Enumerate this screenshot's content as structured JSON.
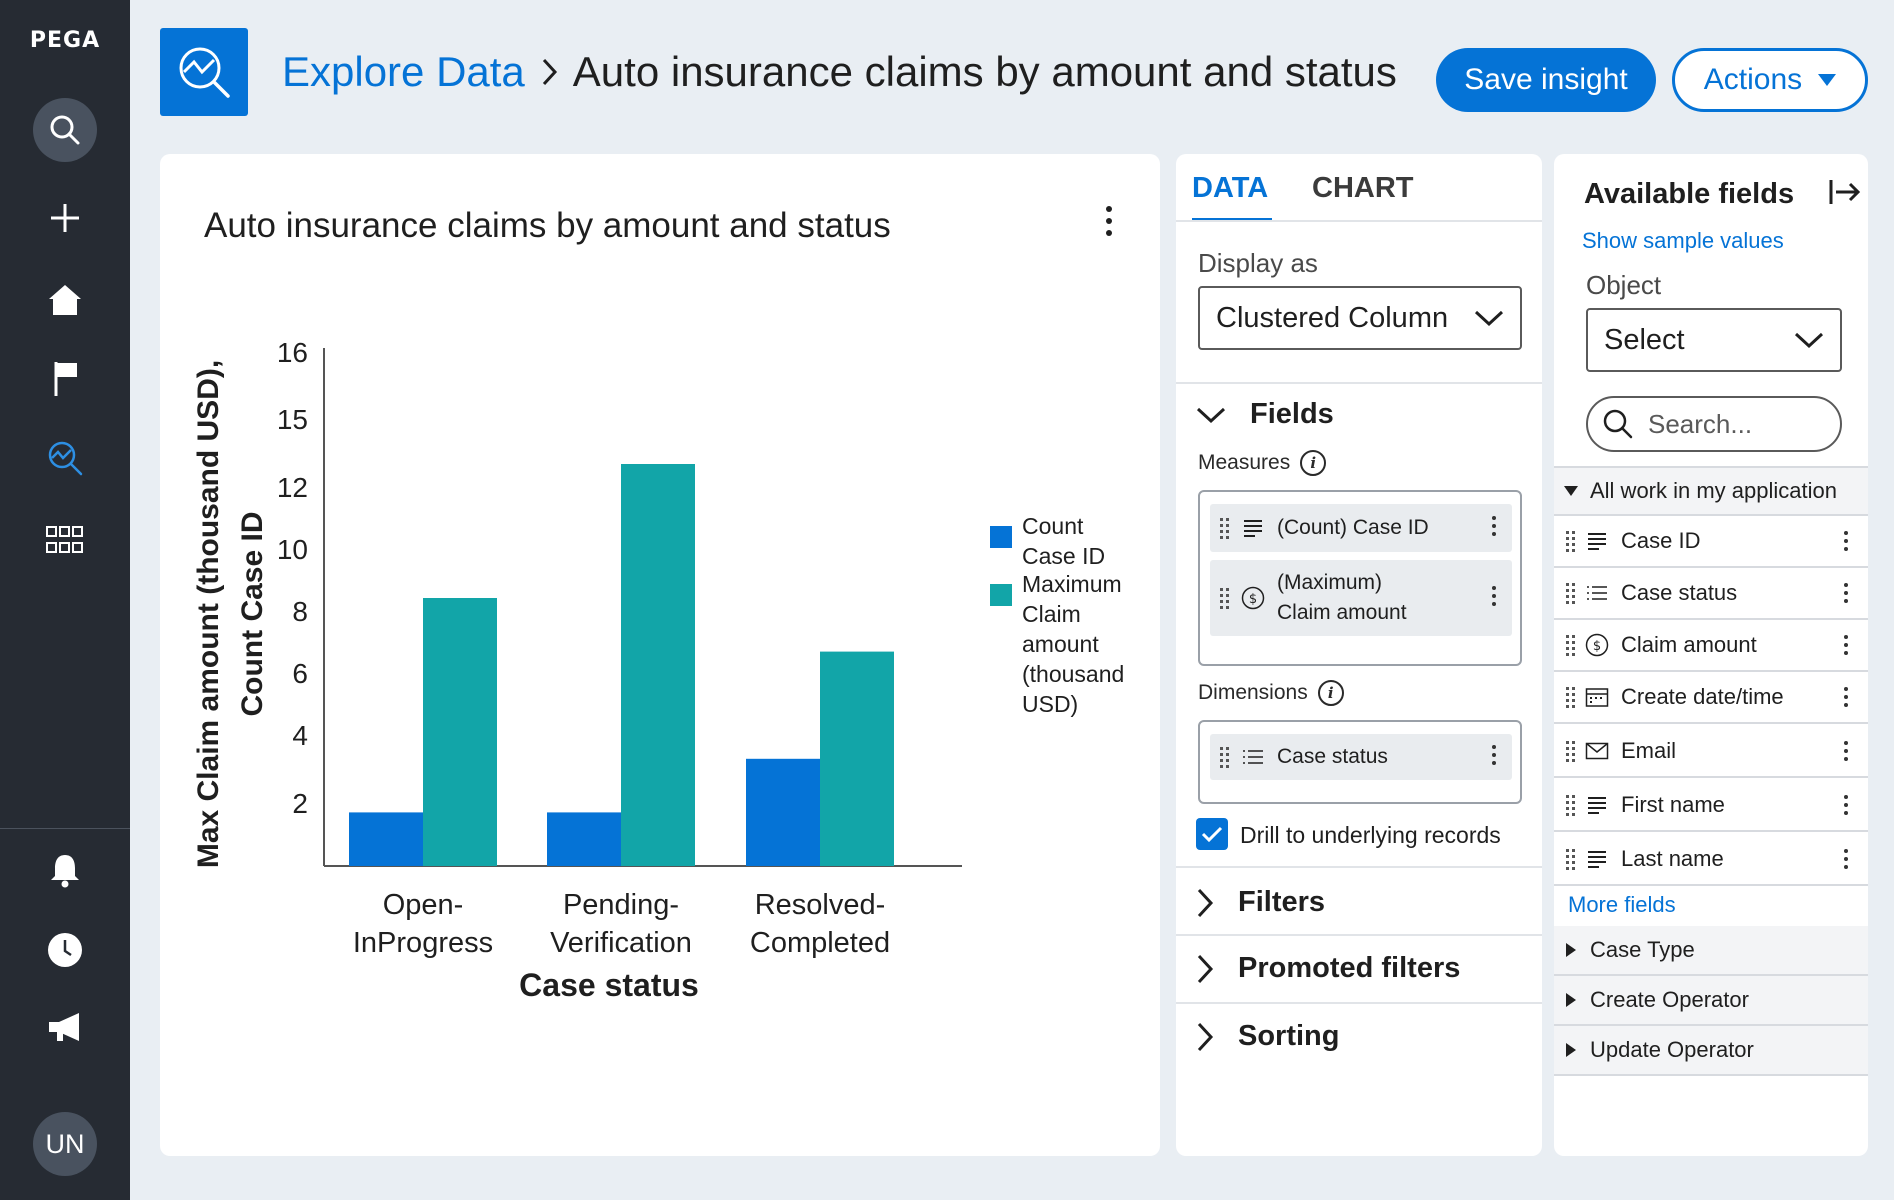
{
  "nav": {
    "brand": "PEGA",
    "avatar_initials": "UN",
    "items": [
      "search-icon",
      "plus-icon",
      "home-icon",
      "flag-icon",
      "explore-data-icon",
      "apps-grid-icon",
      "bell-icon",
      "clock-icon",
      "megaphone-icon"
    ]
  },
  "header": {
    "breadcrumb_link": "Explore Data",
    "title": "Auto insurance claims by amount and status",
    "save_label": "Save insight",
    "actions_label": "Actions"
  },
  "chart_card": {
    "title": "Auto insurance claims by amount and status"
  },
  "chart_data": {
    "type": "bar",
    "categories": [
      [
        "Open-",
        "InProgress"
      ],
      [
        "Pending-",
        "Verification"
      ],
      [
        "Resolved-",
        "Completed"
      ]
    ],
    "series": [
      {
        "name": [
          "Count",
          "Case ID"
        ],
        "values": [
          2,
          2,
          4
        ],
        "color": "#0573d6"
      },
      {
        "name": [
          "Maximum",
          "Claim",
          "amount",
          "(thousand",
          "USD)"
        ],
        "values": [
          10,
          15,
          8
        ],
        "color": "#12a5a8"
      }
    ],
    "yticks": [
      "16",
      "15",
      "12",
      "10",
      "8",
      "6",
      "4",
      "2"
    ],
    "ylabel": [
      "Max Claim amount (thousand USD),",
      "Count Case ID"
    ],
    "xlabel": "Case status",
    "legend_position": "right"
  },
  "config": {
    "tabs": [
      "DATA",
      "CHART"
    ],
    "display_as_label": "Display as",
    "display_as_value": "Clustered Column",
    "fields_heading": "Fields",
    "measures_label": "Measures",
    "measures": [
      {
        "label": "(Count) Case ID",
        "icon": "text-lines-icon"
      },
      {
        "label_line1": "(Maximum)",
        "label_line2": "Claim amount",
        "icon": "currency-icon"
      }
    ],
    "dimensions_label": "Dimensions",
    "dimensions": [
      {
        "label": "Case status",
        "icon": "list-icon"
      }
    ],
    "drill_label": "Drill to underlying records",
    "drill_checked": true,
    "sections": [
      "Filters",
      "Promoted filters",
      "Sorting"
    ]
  },
  "fields_panel": {
    "title": "Available fields",
    "show_sample": "Show sample values",
    "object_label": "Object",
    "object_value": "Select",
    "search_placeholder": "Search...",
    "group_label": "All work in my application",
    "fields": [
      {
        "label": "Case ID",
        "icon": "text-lines-icon"
      },
      {
        "label": "Case status",
        "icon": "list-icon"
      },
      {
        "label": "Claim amount",
        "icon": "currency-icon"
      },
      {
        "label": "Create date/time",
        "icon": "calendar-icon"
      },
      {
        "label": "Email",
        "icon": "envelope-icon"
      },
      {
        "label": "First name",
        "icon": "text-lines-icon"
      },
      {
        "label": "Last name",
        "icon": "text-lines-icon"
      }
    ],
    "more_fields": "More fields",
    "collapsed_groups": [
      "Case Type",
      "Create Operator",
      "Update Operator"
    ]
  }
}
